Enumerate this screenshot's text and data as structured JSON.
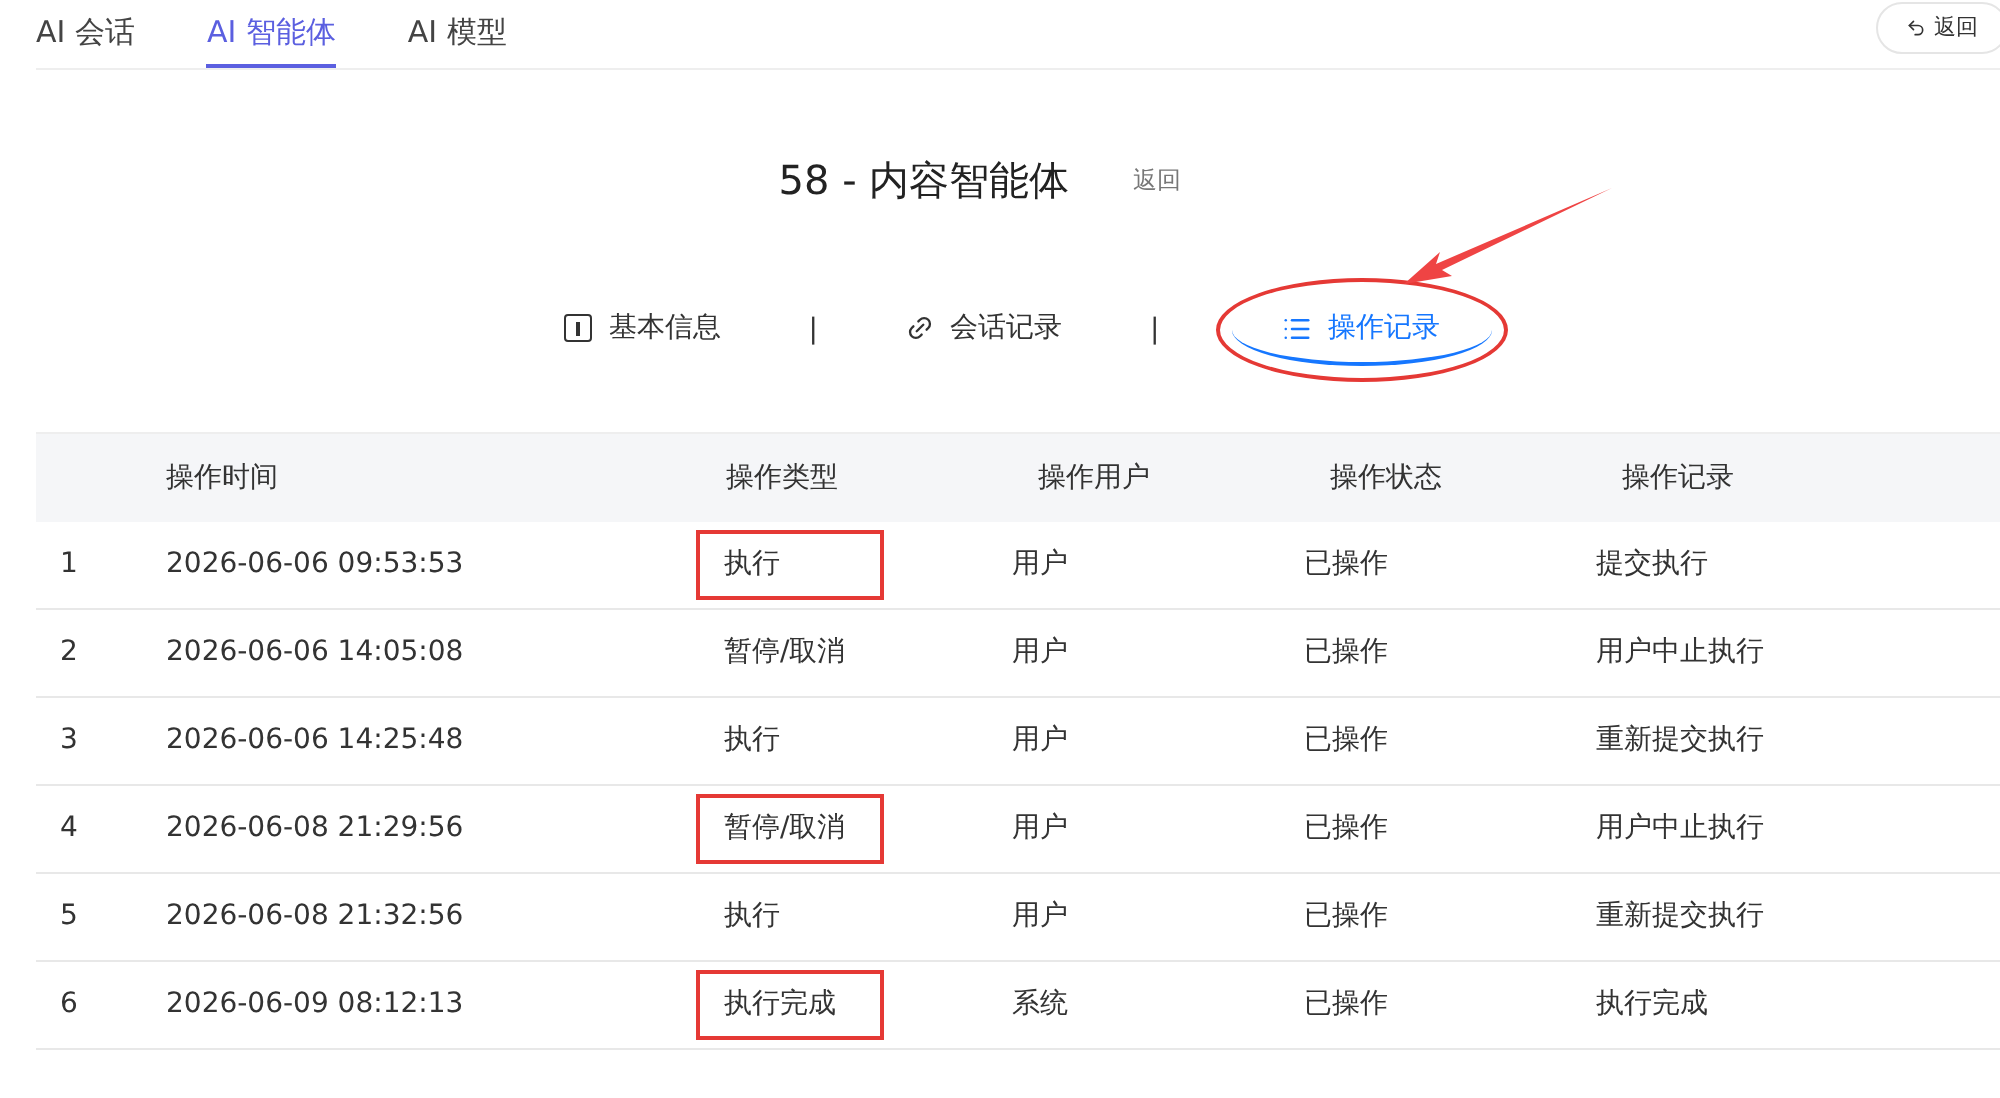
{
  "nav_tabs": [
    {
      "label": "AI 会话",
      "selected": false
    },
    {
      "label": "AI 智能体",
      "selected": true
    },
    {
      "label": "AI 模型",
      "selected": false
    }
  ],
  "back_button": "返回",
  "title": "58 - 内容智能体",
  "title_back": "返回",
  "detail_tabs": [
    {
      "kind": "tab",
      "label": "基本信息",
      "selected": false,
      "circled": false
    },
    {
      "kind": "separator",
      "label": "|"
    },
    {
      "kind": "tab",
      "label": "会话记录",
      "selected": false,
      "circled": false
    },
    {
      "kind": "separator",
      "label": "|"
    },
    {
      "kind": "tab",
      "label": "操作记录",
      "selected": true,
      "circled": true
    }
  ],
  "annotation_arrow": true,
  "table": {
    "columns": [
      "操作时间",
      "操作类型",
      "操作用户",
      "操作状态",
      "操作记录"
    ],
    "rows": [
      {
        "index": "1",
        "time": "2026-06-06 09:53:53",
        "type": "执行",
        "highlighted": true,
        "user": "用户",
        "status": "已操作",
        "record": "提交执行"
      },
      {
        "index": "2",
        "time": "2026-06-06 14:05:08",
        "type": "暂停/取消",
        "highlighted": false,
        "user": "用户",
        "status": "已操作",
        "record": "用户中止执行"
      },
      {
        "index": "3",
        "time": "2026-06-06 14:25:48",
        "type": "执行",
        "highlighted": false,
        "user": "用户",
        "status": "已操作",
        "record": "重新提交执行"
      },
      {
        "index": "4",
        "time": "2026-06-08 21:29:56",
        "type": "暂停/取消",
        "highlighted": true,
        "user": "用户",
        "status": "已操作",
        "record": "用户中止执行"
      },
      {
        "index": "5",
        "time": "2026-06-08 21:32:56",
        "type": "执行",
        "highlighted": false,
        "user": "用户",
        "status": "已操作",
        "record": "重新提交执行"
      },
      {
        "index": "6",
        "time": "2026-06-09 08:12:13",
        "type": "执行完成",
        "highlighted": true,
        "user": "系统",
        "status": "已操作",
        "record": "执行完成"
      }
    ]
  }
}
